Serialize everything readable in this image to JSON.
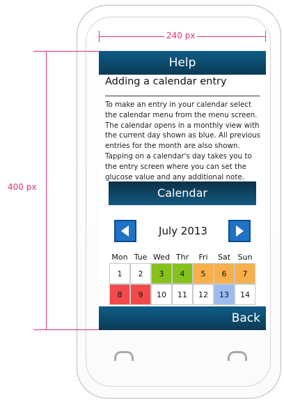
{
  "annotations": {
    "width_label": "240 px",
    "height_label": "400 px",
    "color": "#e0337c"
  },
  "header": {
    "title": "Help"
  },
  "content": {
    "title": "Adding a calendar entry",
    "body": "To make an entry in your calendar select the calendar menu from the menu screen. The calendar opens in a monthly view with the current day shown as blue. All previous entries for the month are also shown. Tapping on a calendar's day takes you to the entry screen where you can set the glucose value and any additional note."
  },
  "calendar": {
    "banner_label": "Calendar",
    "month_label": "July 2013",
    "prev_icon": "left-arrow-icon",
    "next_icon": "right-arrow-icon",
    "weekdays": [
      "Mon",
      "Tue",
      "Wed",
      "Thr",
      "Fri",
      "Sat",
      "Sun"
    ],
    "days": [
      {
        "day": "1",
        "color": "#ffffff"
      },
      {
        "day": "2",
        "color": "#ffffff"
      },
      {
        "day": "3",
        "color": "#86c21c"
      },
      {
        "day": "4",
        "color": "#86c21c"
      },
      {
        "day": "5",
        "color": "#f7b04a"
      },
      {
        "day": "6",
        "color": "#f7b04a"
      },
      {
        "day": "7",
        "color": "#f7b04a"
      },
      {
        "day": "8",
        "color": "#f24a4a"
      },
      {
        "day": "9",
        "color": "#f24a4a"
      },
      {
        "day": "10",
        "color": "#ffffff"
      },
      {
        "day": "11",
        "color": "#ffffff"
      },
      {
        "day": "12",
        "color": "#ffffff"
      },
      {
        "day": "13",
        "color": "#9cbbf0"
      },
      {
        "day": "14",
        "color": "#ffffff"
      }
    ]
  },
  "footer": {
    "back_label": "Back"
  }
}
